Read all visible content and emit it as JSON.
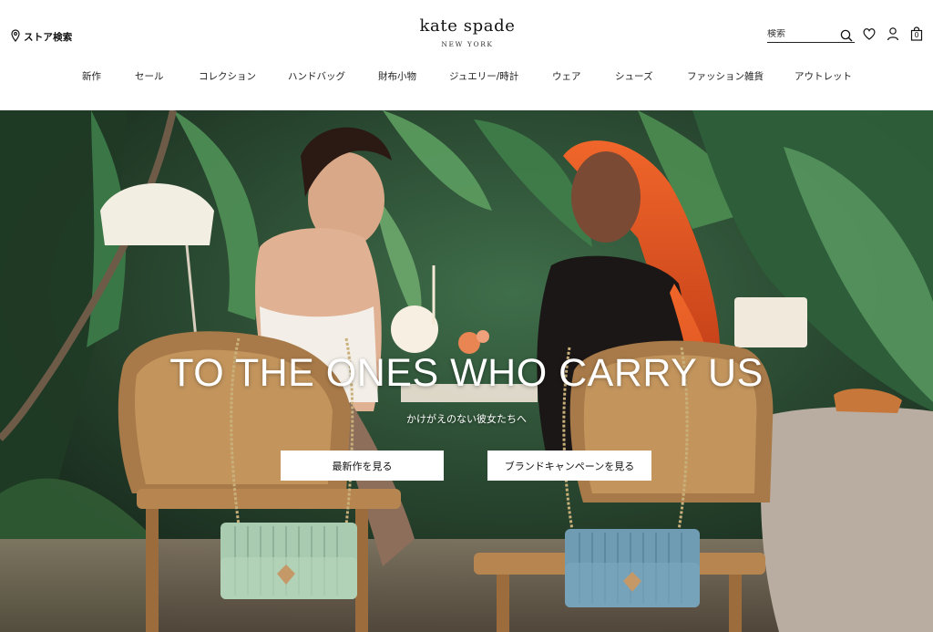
{
  "header": {
    "store_locator": "ストア検索",
    "logo": {
      "main": "kate spade",
      "sub": "NEW YORK"
    },
    "search": {
      "placeholder": "検索"
    },
    "bag_count": "0"
  },
  "nav": {
    "items": [
      "新作",
      "セール",
      "コレクション",
      "ハンドバッグ",
      "財布小物",
      "ジュエリー/時計",
      "ウェア",
      "シューズ",
      "ファッション雑貨",
      "アウトレット"
    ]
  },
  "hero": {
    "title": "TO THE ONES WHO CARRY US",
    "subtitle": "かけがえのない彼女たちへ",
    "buttons": {
      "new": "最新作を見る",
      "campaign": "ブランドキャンペーンを見る"
    }
  },
  "colors": {
    "text": "#222222",
    "hero_text": "#ffffff",
    "button_bg": "#ffffff",
    "foliage": "#2f5b3a",
    "hair_orange": "#e8521e",
    "bag_mint": "#a9cbb0",
    "bag_blue": "#6f9bb3"
  },
  "icons": [
    "location-pin-icon",
    "search-icon",
    "heart-icon",
    "user-icon",
    "shopping-bag-icon"
  ]
}
